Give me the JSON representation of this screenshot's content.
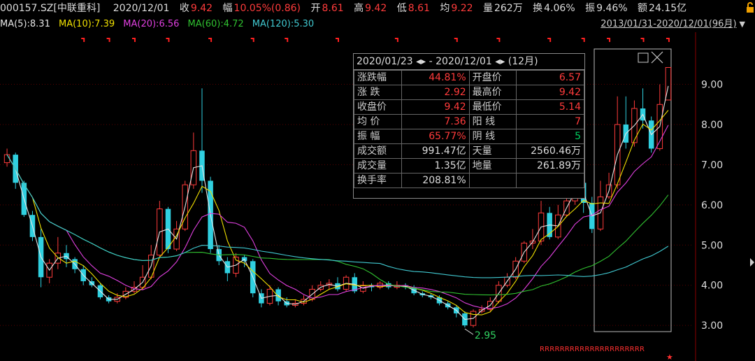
{
  "header": {
    "code": "000157.SZ[中联重科]",
    "date": "2020/12/01",
    "close_label": "收",
    "close": "9.42",
    "change_label": "幅",
    "change": "10.05%(0.86)",
    "open_label": "开",
    "open": "8.61",
    "high_label": "高",
    "high": "9.42",
    "low_label": "低",
    "low": "8.61",
    "avg_label": "均",
    "avg": "9.22",
    "vol_label": "量",
    "vol": "262万",
    "turnover_label": "换",
    "turnover": "4.06%",
    "amp_label": "振",
    "amp": "9.46%",
    "amount_label": "额",
    "amount": "24.15亿"
  },
  "ma_bar": [
    {
      "label": "MA(5):8.31",
      "color": "#e6e6e6"
    },
    {
      "label": "MA(10):7.39",
      "color": "#f0e000"
    },
    {
      "label": "MA(20):6.56",
      "color": "#e040e0"
    },
    {
      "label": "MA(60):4.72",
      "color": "#30c030"
    },
    {
      "label": "MA(120):5.30",
      "color": "#40c8d0"
    }
  ],
  "range_text": "2013/01/31-2020/12/01(96月)",
  "panel": {
    "title": "2020/01/23 ◂▸ - 2020/12/01 ◂▸  (12月)",
    "rows": [
      {
        "k1": "涨跌幅",
        "v1": "44.81%",
        "c1": "red",
        "k2": "开盘价",
        "v2": "6.57",
        "c2": "red"
      },
      {
        "k1": "涨  跌",
        "v1": "2.92",
        "c1": "red",
        "k2": "最高价",
        "v2": "9.42",
        "c2": "red"
      },
      {
        "k1": "收盘价",
        "v1": "9.42",
        "c1": "red",
        "k2": "最低价",
        "v2": "5.14",
        "c2": "red"
      },
      {
        "k1": "均  价",
        "v1": "7.36",
        "c1": "red",
        "k2": "阳  线",
        "v2": "7",
        "c2": "red"
      },
      {
        "k1": "振  幅",
        "v1": "65.77%",
        "c1": "red",
        "k2": "阴  线",
        "v2": "5",
        "c2": "grn"
      },
      {
        "k1": "成交额",
        "v1": "991.47亿",
        "c1": "wht",
        "k2": "天量",
        "v2": "2560.46万",
        "c2": "wht"
      },
      {
        "k1": "成交量",
        "v1": "1.35亿",
        "c1": "wht",
        "k2": "地量",
        "v2": "261.89万",
        "c2": "wht"
      },
      {
        "k1": "换手率",
        "v1": "208.81%",
        "c1": "wht",
        "k2": "",
        "v2": "",
        "c2": "wht"
      }
    ]
  },
  "chart_data": {
    "type": "candlestick",
    "y_ticks": [
      "9.00",
      "8.00",
      "7.00",
      "6.00",
      "5.00",
      "4.00",
      "3.00"
    ],
    "y_tick_values": [
      9,
      8,
      7,
      6,
      5,
      4,
      3
    ],
    "ylim": [
      2.55,
      9.95
    ],
    "min_annotation": "2.95",
    "bottom_marks": "RRRRRRRRRRRRRRRRRRRRR",
    "colors": {
      "up": "#ff3b3b",
      "down": "#30d0e0",
      "ma5": "#e6e6e6",
      "ma10": "#f0e000",
      "ma20": "#e040e0",
      "ma60": "#30c030",
      "ma120": "#40c8d0",
      "grid": "#5a0000",
      "axis": "#8b0000"
    },
    "candles": [
      [
        7.05,
        7.25,
        7.4,
        6.95
      ],
      [
        7.25,
        6.55,
        7.3,
        6.4
      ],
      [
        6.55,
        5.75,
        6.6,
        5.7
      ],
      [
        5.75,
        5.2,
        5.85,
        5.1
      ],
      [
        5.2,
        4.2,
        5.4,
        3.95
      ],
      [
        4.2,
        4.55,
        4.65,
        4.05
      ],
      [
        4.55,
        4.8,
        5.2,
        4.4
      ],
      [
        4.8,
        4.65,
        5.0,
        4.45
      ],
      [
        4.65,
        4.4,
        4.7,
        4.3
      ],
      [
        4.4,
        4.1,
        4.5,
        4.0
      ],
      [
        4.1,
        4.0,
        4.2,
        3.95
      ],
      [
        4.0,
        3.7,
        4.05,
        3.65
      ],
      [
        3.7,
        3.6,
        3.75,
        3.55
      ],
      [
        3.6,
        3.7,
        3.8,
        3.55
      ],
      [
        3.7,
        3.85,
        3.95,
        3.65
      ],
      [
        3.85,
        3.95,
        4.1,
        3.8
      ],
      [
        3.95,
        4.2,
        4.5,
        3.9
      ],
      [
        4.2,
        4.75,
        5.0,
        4.15
      ],
      [
        4.75,
        5.9,
        6.1,
        4.7
      ],
      [
        5.9,
        4.9,
        5.95,
        4.8
      ],
      [
        4.9,
        5.4,
        5.6,
        4.85
      ],
      [
        5.4,
        6.5,
        6.6,
        5.35
      ],
      [
        6.5,
        7.35,
        7.8,
        6.4
      ],
      [
        7.35,
        6.6,
        8.9,
        6.3
      ],
      [
        6.6,
        4.9,
        6.7,
        4.8
      ],
      [
        4.9,
        4.6,
        5.0,
        4.5
      ],
      [
        4.6,
        4.3,
        4.7,
        4.1
      ],
      [
        4.3,
        4.7,
        4.8,
        4.2
      ],
      [
        4.7,
        4.6,
        4.75,
        4.45
      ],
      [
        4.6,
        3.8,
        4.65,
        3.7
      ],
      [
        3.8,
        3.55,
        3.9,
        3.45
      ],
      [
        3.55,
        3.9,
        4.0,
        3.5
      ],
      [
        3.9,
        3.6,
        3.95,
        3.5
      ],
      [
        3.6,
        3.5,
        3.7,
        3.45
      ],
      [
        3.5,
        3.55,
        3.65,
        3.45
      ],
      [
        3.55,
        3.65,
        3.75,
        3.5
      ],
      [
        3.65,
        3.9,
        4.0,
        3.6
      ],
      [
        3.9,
        4.0,
        4.1,
        3.85
      ],
      [
        4.0,
        4.05,
        4.15,
        3.9
      ],
      [
        4.05,
        3.9,
        4.2,
        3.85
      ],
      [
        3.9,
        4.2,
        4.25,
        3.85
      ],
      [
        4.2,
        3.85,
        4.3,
        3.8
      ],
      [
        3.85,
        4.0,
        4.1,
        3.8
      ],
      [
        4.0,
        3.95,
        4.05,
        3.85
      ],
      [
        3.95,
        4.05,
        4.1,
        3.9
      ],
      [
        4.05,
        3.95,
        4.1,
        3.9
      ],
      [
        3.95,
        4.0,
        4.1,
        3.9
      ],
      [
        4.0,
        3.95,
        4.05,
        3.9
      ],
      [
        3.95,
        3.8,
        4.0,
        3.75
      ],
      [
        3.8,
        3.75,
        3.85,
        3.7
      ],
      [
        3.75,
        3.7,
        3.8,
        3.65
      ],
      [
        3.7,
        3.55,
        3.75,
        3.5
      ],
      [
        3.55,
        3.45,
        3.6,
        3.4
      ],
      [
        3.45,
        3.3,
        3.5,
        3.2
      ],
      [
        3.3,
        3.0,
        3.35,
        2.95
      ],
      [
        3.0,
        3.35,
        3.4,
        2.95
      ],
      [
        3.35,
        3.4,
        3.5,
        3.3
      ],
      [
        3.4,
        3.6,
        3.7,
        3.35
      ],
      [
        3.6,
        4.0,
        4.1,
        3.55
      ],
      [
        4.0,
        4.2,
        4.3,
        3.95
      ],
      [
        4.2,
        4.6,
        4.7,
        4.15
      ],
      [
        4.6,
        5.05,
        5.1,
        4.55
      ],
      [
        5.05,
        5.1,
        5.4,
        4.9
      ],
      [
        5.1,
        5.8,
        6.1,
        5.0
      ],
      [
        5.8,
        5.2,
        5.95,
        5.14
      ],
      [
        5.2,
        5.75,
        6.0,
        5.15
      ],
      [
        5.75,
        6.1,
        6.3,
        5.7
      ],
      [
        6.1,
        6.55,
        6.7,
        6.0
      ],
      [
        6.55,
        6.05,
        6.85,
        5.8
      ],
      [
        6.05,
        5.4,
        6.2,
        5.3
      ],
      [
        5.4,
        6.2,
        6.6,
        5.35
      ],
      [
        6.2,
        6.5,
        6.8,
        6.15
      ],
      [
        6.5,
        8.0,
        8.7,
        6.4
      ],
      [
        8.0,
        7.55,
        8.7,
        7.4
      ],
      [
        7.55,
        8.4,
        8.6,
        7.45
      ],
      [
        8.4,
        8.1,
        8.9,
        7.9
      ],
      [
        8.1,
        7.4,
        8.2,
        7.3
      ],
      [
        7.4,
        8.5,
        9.0,
        7.35
      ],
      [
        8.61,
        9.42,
        9.42,
        8.61
      ]
    ]
  }
}
